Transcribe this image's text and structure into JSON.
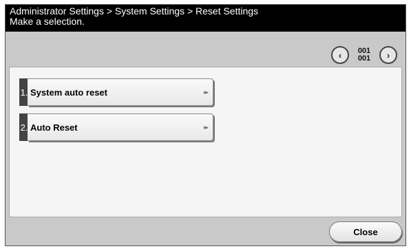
{
  "header": {
    "breadcrumb": "Administrator Settings > System Settings > Reset Settings",
    "instruction": "Make a selection."
  },
  "pager": {
    "prev_icon": "chevron-left-icon",
    "next_icon": "chevron-right-icon",
    "current": "001",
    "total": "001"
  },
  "menu": {
    "items": [
      {
        "number": "1.",
        "label": "System auto reset"
      },
      {
        "number": "2.",
        "label": "Auto Reset"
      }
    ]
  },
  "footer": {
    "close_label": "Close"
  }
}
